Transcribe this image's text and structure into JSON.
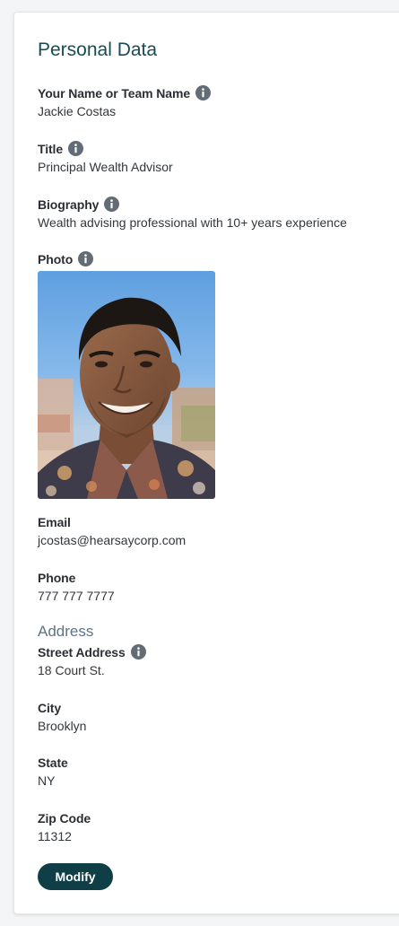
{
  "card": {
    "title": "Personal Data",
    "fields": {
      "name": {
        "label": "Your Name or Team Name",
        "value": "Jackie Costas"
      },
      "title": {
        "label": "Title",
        "value": "Principal Wealth Advisor"
      },
      "biography": {
        "label": "Biography",
        "value": "Wealth advising professional with 10+ years experience"
      },
      "photo": {
        "label": "Photo"
      },
      "email": {
        "label": "Email",
        "value": "jcostas@hearsaycorp.com"
      },
      "phone": {
        "label": "Phone",
        "value": "777 777 7777"
      }
    },
    "address": {
      "title": "Address",
      "street": {
        "label": "Street Address",
        "value": "18 Court St."
      },
      "city": {
        "label": "City",
        "value": "Brooklyn"
      },
      "state": {
        "label": "State",
        "value": "NY"
      },
      "zip": {
        "label": "Zip Code",
        "value": "11312"
      }
    },
    "modify_label": "Modify"
  },
  "icons": {
    "info": "info-circle-icon"
  },
  "colors": {
    "title": "#174d52",
    "section_title": "#5f7386",
    "info_icon": "#636b75",
    "button": "#0f3e46"
  }
}
